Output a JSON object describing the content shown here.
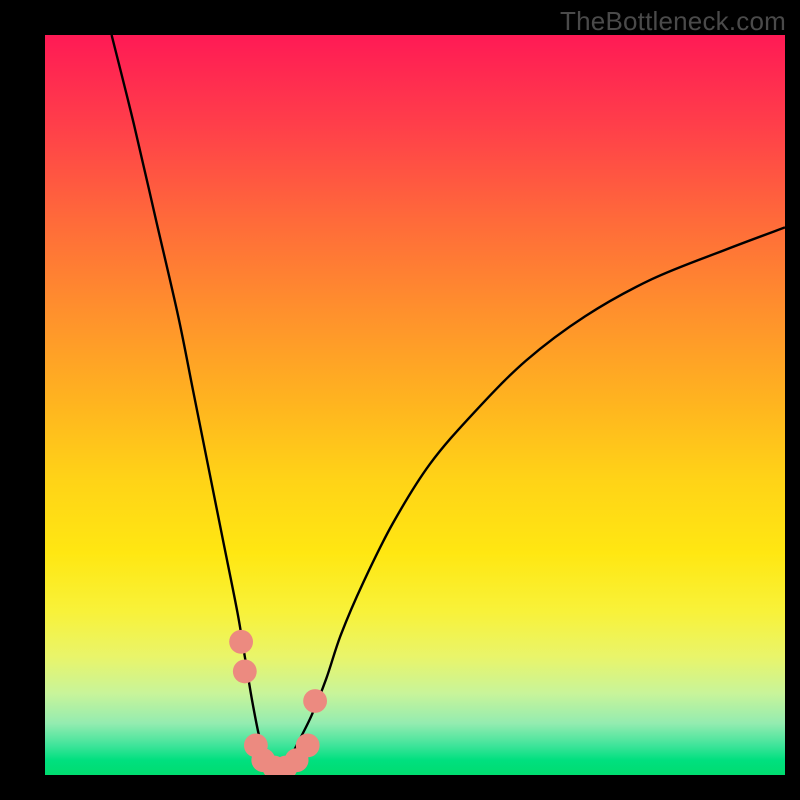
{
  "watermark": "TheBottleneck.com",
  "chart_data": {
    "type": "line",
    "title": "",
    "xlabel": "",
    "ylabel": "",
    "xlim": [
      0,
      100
    ],
    "ylim": [
      0,
      100
    ],
    "grid": false,
    "series": [
      {
        "name": "curve",
        "x": [
          9,
          12,
          15,
          18,
          20,
          22,
          24,
          26,
          27,
          28,
          29,
          30,
          31,
          32,
          33,
          34,
          36,
          38,
          40,
          43,
          47,
          52,
          58,
          65,
          73,
          82,
          92,
          100
        ],
        "y": [
          100,
          88,
          75,
          62,
          52,
          42,
          32,
          22,
          16,
          10,
          5,
          2,
          1,
          1,
          2,
          4,
          8,
          13,
          19,
          26,
          34,
          42,
          49,
          56,
          62,
          67,
          71,
          74
        ]
      }
    ],
    "markers": [
      {
        "x": 26.5,
        "y": 18,
        "r": 1.6
      },
      {
        "x": 27.0,
        "y": 14,
        "r": 1.6
      },
      {
        "x": 28.5,
        "y": 4,
        "r": 1.6
      },
      {
        "x": 29.5,
        "y": 2,
        "r": 1.6
      },
      {
        "x": 31.0,
        "y": 1,
        "r": 1.6
      },
      {
        "x": 32.5,
        "y": 1,
        "r": 1.6
      },
      {
        "x": 34.0,
        "y": 2,
        "r": 1.6
      },
      {
        "x": 35.5,
        "y": 4,
        "r": 1.6
      },
      {
        "x": 36.5,
        "y": 10,
        "r": 1.6
      }
    ],
    "gradient_stops": [
      {
        "pos": 0,
        "color": "#ff1a55"
      },
      {
        "pos": 50,
        "color": "#ffb51f"
      },
      {
        "pos": 78,
        "color": "#f8f23a"
      },
      {
        "pos": 100,
        "color": "#00dc70"
      }
    ]
  }
}
